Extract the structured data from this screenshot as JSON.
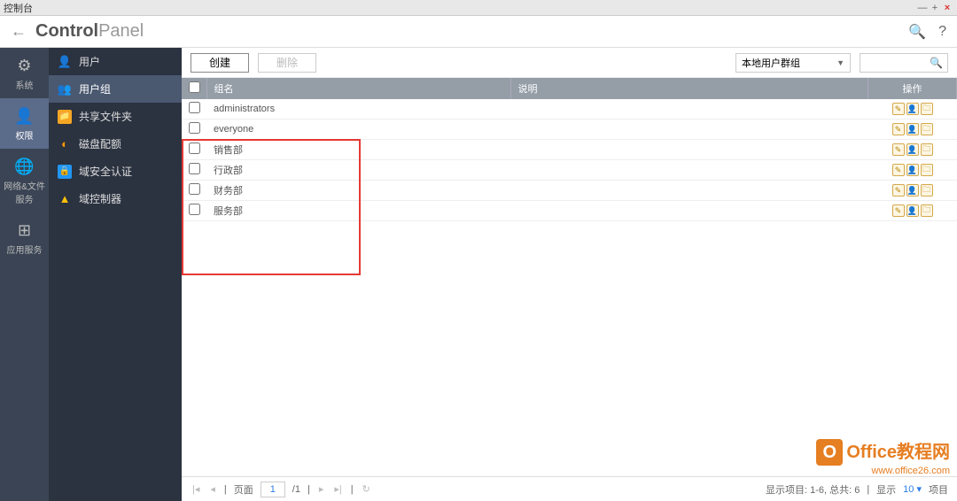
{
  "titlebar": {
    "title": "控制台",
    "min": "—",
    "max": "+",
    "close": "×"
  },
  "header": {
    "title_bold": "Control",
    "title_thin": "Panel",
    "search": "🔍",
    "help": "?"
  },
  "leftnav": [
    {
      "icon": "⚙",
      "label": "系统"
    },
    {
      "icon": "👤",
      "label": "权限"
    },
    {
      "icon": "🌐",
      "label": "网络&文件服务"
    },
    {
      "icon": "⊞",
      "label": "应用服务"
    }
  ],
  "subnav": [
    {
      "icon": "👤",
      "label": "用户"
    },
    {
      "icon": "👥",
      "label": "用户组"
    },
    {
      "icon": "📁",
      "label": "共享文件夹"
    },
    {
      "icon": "◐",
      "label": "磁盘配额"
    },
    {
      "icon": "🔒",
      "label": "域安全认证"
    },
    {
      "icon": "▲",
      "label": "域控制器"
    }
  ],
  "toolbar": {
    "create": "创建",
    "delete": "删除",
    "scope": "本地用户群组"
  },
  "columns": {
    "name": "组名",
    "desc": "说明",
    "action": "操作"
  },
  "rows": [
    {
      "name": "administrators",
      "desc": ""
    },
    {
      "name": "everyone",
      "desc": ""
    },
    {
      "name": "销售部",
      "desc": ""
    },
    {
      "name": "行政部",
      "desc": ""
    },
    {
      "name": "财务部",
      "desc": ""
    },
    {
      "name": "服务部",
      "desc": ""
    }
  ],
  "pager": {
    "page_label": "页面",
    "page": "1",
    "total": "1",
    "summary_left": "显示项目: 1-6, 总共: 6",
    "show_label": "显示",
    "show_value": "10",
    "items_label": "项目"
  },
  "watermark": {
    "brand": "Office教程网",
    "url": "www.office26.com"
  }
}
